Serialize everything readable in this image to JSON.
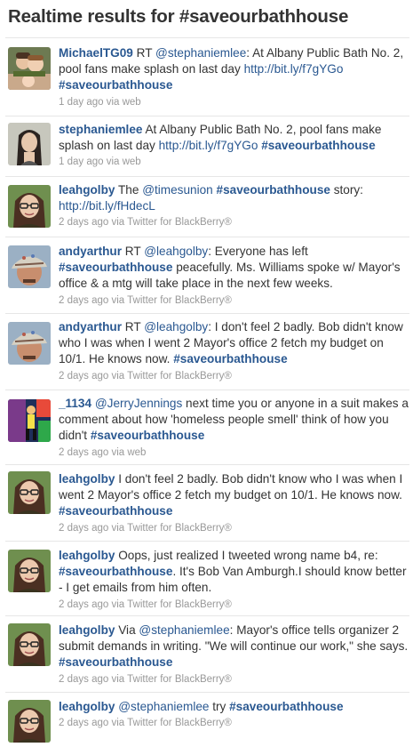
{
  "page": {
    "title": "Realtime results for #saveourbathhouse"
  },
  "colors": {
    "link": "#2a5891",
    "text": "#333333",
    "meta": "#999999",
    "divider": "#e6e6e6"
  },
  "tweets": [
    {
      "user": "MichaelTG09",
      "avatar": "avatar-couple",
      "parts": [
        {
          "t": "text",
          "v": " RT "
        },
        {
          "t": "mention",
          "v": "@stephaniemlee"
        },
        {
          "t": "text",
          "v": ": At Albany Public Bath No. 2, pool fans make splash on last day "
        },
        {
          "t": "url",
          "v": "http://bit.ly/f7gYGo"
        },
        {
          "t": "text",
          "v": " "
        },
        {
          "t": "hashtag",
          "v": "#saveourbathhouse"
        }
      ],
      "meta": "1 day ago via web"
    },
    {
      "user": "stephaniemlee",
      "avatar": "avatar-woman-dark-hair",
      "parts": [
        {
          "t": "text",
          "v": " At Albany Public Bath No. 2, pool fans make splash on last day "
        },
        {
          "t": "url",
          "v": "http://bit.ly/f7gYGo"
        },
        {
          "t": "text",
          "v": " "
        },
        {
          "t": "hashtag",
          "v": "#saveourbathhouse"
        }
      ],
      "meta": "1 day ago via web"
    },
    {
      "user": "leahgolby",
      "avatar": "avatar-woman-glasses",
      "parts": [
        {
          "t": "text",
          "v": " The "
        },
        {
          "t": "mention",
          "v": "@timesunion"
        },
        {
          "t": "text",
          "v": " "
        },
        {
          "t": "hashtag",
          "v": "#saveourbathhouse"
        },
        {
          "t": "text",
          "v": " story: "
        },
        {
          "t": "url",
          "v": "http://bit.ly/fHdecL"
        }
      ],
      "meta": "2 days ago via Twitter for BlackBerry®"
    },
    {
      "user": "andyarthur",
      "avatar": "avatar-man-cap",
      "parts": [
        {
          "t": "text",
          "v": " RT "
        },
        {
          "t": "mention",
          "v": "@leahgolby"
        },
        {
          "t": "text",
          "v": ": Everyone has left "
        },
        {
          "t": "hashtag",
          "v": "#saveourbathhouse"
        },
        {
          "t": "text",
          "v": " peacefully. Ms. Williams spoke w/ Mayor's office & a mtg will take place in the next few weeks."
        }
      ],
      "meta": "2 days ago via Twitter for BlackBerry®"
    },
    {
      "user": "andyarthur",
      "avatar": "avatar-man-cap",
      "parts": [
        {
          "t": "text",
          "v": " RT "
        },
        {
          "t": "mention",
          "v": "@leahgolby"
        },
        {
          "t": "text",
          "v": ": I don't feel 2 badly. Bob didn't know who I was when I went 2 Mayor's office 2 fetch my budget on 10/1. He knows now. "
        },
        {
          "t": "hashtag",
          "v": "#saveourbathhouse"
        }
      ],
      "meta": "2 days ago via Twitter for BlackBerry®"
    },
    {
      "user": "_1134",
      "avatar": "avatar-figure-art",
      "parts": [
        {
          "t": "text",
          "v": " "
        },
        {
          "t": "mention",
          "v": "@JerryJennings"
        },
        {
          "t": "text",
          "v": " next time you or anyone in a suit makes a comment about how 'homeless people smell' think of how you didn't "
        },
        {
          "t": "hashtag",
          "v": "#saveourbathhouse"
        }
      ],
      "meta": "2 days ago via web"
    },
    {
      "user": "leahgolby",
      "avatar": "avatar-woman-glasses",
      "parts": [
        {
          "t": "text",
          "v": " I don't feel 2 badly. Bob didn't know who I was when I went 2 Mayor's office 2 fetch my budget on 10/1. He knows now. "
        },
        {
          "t": "hashtag",
          "v": "#saveourbathhouse"
        }
      ],
      "meta": "2 days ago via Twitter for BlackBerry®"
    },
    {
      "user": "leahgolby",
      "avatar": "avatar-woman-glasses",
      "parts": [
        {
          "t": "text",
          "v": " Oops, just realized I tweeted wrong name b4, re: "
        },
        {
          "t": "hashtag",
          "v": "#saveourbathhouse"
        },
        {
          "t": "text",
          "v": ". It's Bob Van Amburgh.I should know better - I get emails from him often."
        }
      ],
      "meta": "2 days ago via Twitter for BlackBerry®"
    },
    {
      "user": "leahgolby",
      "avatar": "avatar-woman-glasses",
      "parts": [
        {
          "t": "text",
          "v": " Via "
        },
        {
          "t": "mention",
          "v": "@stephaniemlee"
        },
        {
          "t": "text",
          "v": ": Mayor's office tells organizer 2 submit demands in writing. \"We will continue our work,\" she says. "
        },
        {
          "t": "hashtag",
          "v": "#saveourbathhouse"
        }
      ],
      "meta": "2 days ago via Twitter for BlackBerry®"
    },
    {
      "user": "leahgolby",
      "avatar": "avatar-woman-glasses",
      "parts": [
        {
          "t": "text",
          "v": " "
        },
        {
          "t": "mention",
          "v": "@stephaniemlee"
        },
        {
          "t": "text",
          "v": " try "
        },
        {
          "t": "hashtag",
          "v": "#saveourbathhouse"
        }
      ],
      "meta": "2 days ago via Twitter for BlackBerry®"
    }
  ]
}
